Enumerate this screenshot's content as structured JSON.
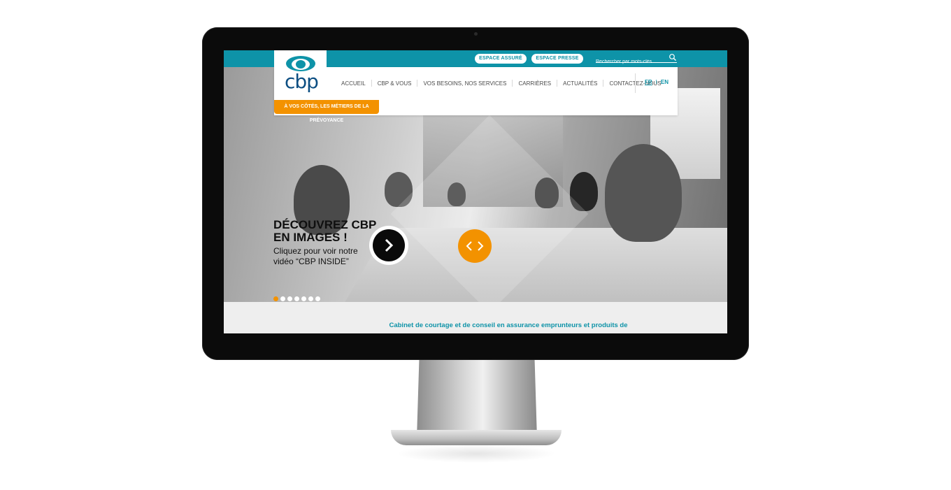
{
  "topbar": {
    "espace_assure": "ESPACE ASSURÉ",
    "espace_presse": "ESPACE PRESSE",
    "search_placeholder": "Rechercher par mots-clés"
  },
  "logo": {
    "text": "cbp"
  },
  "tagline": "À VOS CÔTÉS, LES MÉTIERS DE LA PRÉVOYANCE",
  "nav": {
    "items": [
      {
        "label": "ACCUEIL"
      },
      {
        "label": "CBP & VOUS"
      },
      {
        "label": "VOS BESOINS, NOS SERVICES"
      },
      {
        "label": "CARRIÈRES"
      },
      {
        "label": "ACTUALITÉS"
      },
      {
        "label": "CONTACTEZ-NOUS"
      }
    ],
    "lang_fr": "FR",
    "lang_sep": "I",
    "lang_en": "EN"
  },
  "hero": {
    "title_line1": "DÉCOUVREZ CBP",
    "title_line2": "EN IMAGES !",
    "sub_line1": "Cliquez pour voir notre",
    "sub_line2": "vidéo “CBP INSIDE”",
    "slides_total": 7,
    "active_slide": 1
  },
  "content": {
    "description": "Cabinet de courtage et de conseil en assurance emprunteurs et produits de"
  },
  "colors": {
    "brand_teal": "#0e93a8",
    "brand_orange": "#f39200",
    "logo_blue": "#0c4e82"
  }
}
